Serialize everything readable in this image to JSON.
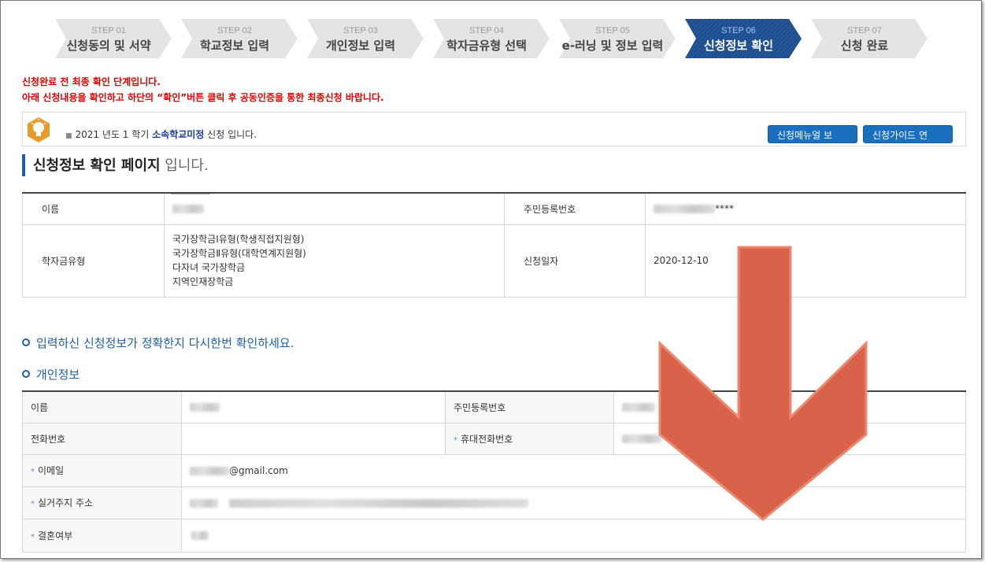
{
  "steps": [
    {
      "num": "STEP 01",
      "label": "신청동의 및 서약"
    },
    {
      "num": "STEP 02",
      "label": "학교정보 입력"
    },
    {
      "num": "STEP 03",
      "label": "개인정보 입력"
    },
    {
      "num": "STEP 04",
      "label": "학자금유형 선택"
    },
    {
      "num": "STEP 05",
      "label": "e-러닝 및 정보 입력"
    },
    {
      "num": "STEP 06",
      "label": "신청정보 확인"
    },
    {
      "num": "STEP 07",
      "label": "신청 완료"
    }
  ],
  "active_step_index": 5,
  "notices": {
    "line1": "신청완료 전 최종 확인 단계입니다.",
    "line2": "아래 신청내용을 확인하고 하단의 “확인”버튼 클릭 후 공동인증을 통한 최종신청 바랍니다."
  },
  "info": {
    "prefix": "2021 년도 1 학기 ",
    "highlight": "소속학교미정",
    "suffix": " 신청 입니다.",
    "btn_manual": "신청메뉴얼 보기",
    "btn_guide": "신청가이드 연결"
  },
  "page_title": {
    "strong": "신청정보 확인 페이지",
    "light": " 입니다."
  },
  "summary": {
    "name_label": "이름",
    "rrn_label": "주민등록번호",
    "rrn_value_suffix": "****",
    "type_label": "학자금유형",
    "types": [
      "국가장학금Ⅰ유형(학생직접지원형)",
      "국가장학금Ⅱ유형(대학연계지원형)",
      "다자녀 국가장학금",
      "지역인재장학금"
    ],
    "date_label": "신청일자",
    "date_value": "2020-12-10"
  },
  "section1": "입력하신 신청정보가 정확한지 다시한번 확인하세요.",
  "section2": "개인정보",
  "personal": {
    "name_label": "이름",
    "rrn_label": "주민등록번호",
    "phone_label": "전화번호",
    "mobile_label": "휴대전화번호",
    "email_label": "이메일",
    "email_suffix": "@gmail.com",
    "address_label": "실거주지 주소",
    "married_label": "결혼여부"
  },
  "colors": {
    "accent": "#1f5fa8",
    "active_step": "#1f4e8c",
    "notice": "#e10000",
    "arrow": "#d9624a"
  }
}
